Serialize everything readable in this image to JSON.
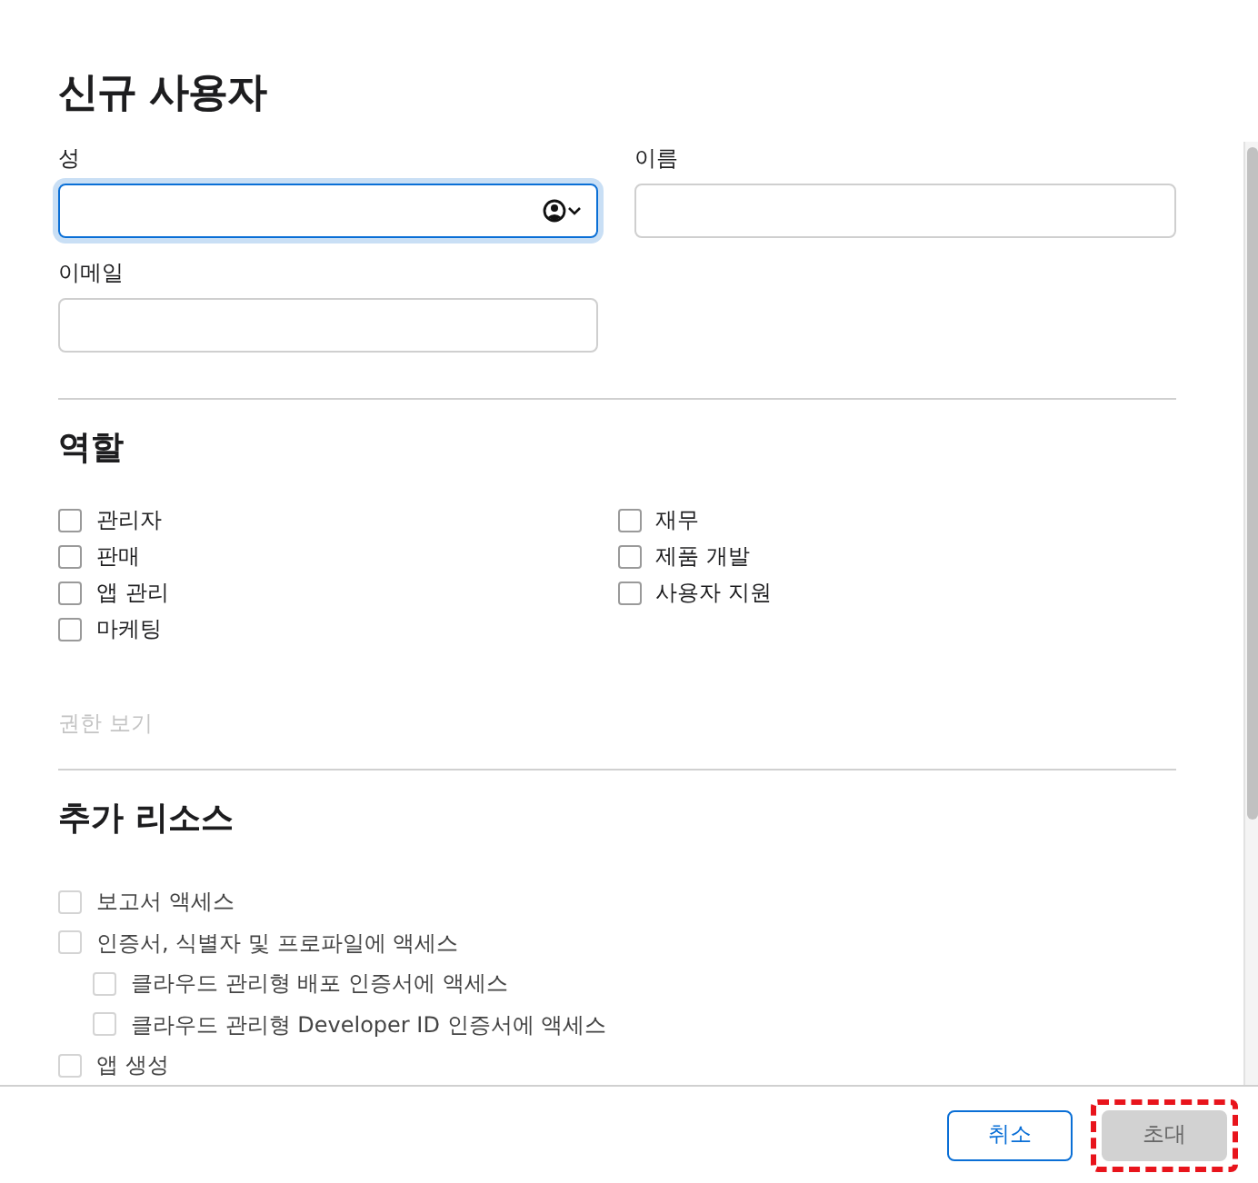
{
  "title": "신규 사용자",
  "fields": [
    {
      "label": "성",
      "focused": true,
      "contact_menu": true
    },
    {
      "label": "이름",
      "focused": false,
      "contact_menu": false
    },
    {
      "label": "이메일",
      "focused": false,
      "contact_menu": false
    }
  ],
  "roles": {
    "heading": "역할",
    "columns": [
      [
        {
          "label": "관리자",
          "checked": false
        },
        {
          "label": "판매",
          "checked": false
        },
        {
          "label": "앱 관리",
          "checked": false
        },
        {
          "label": "마케팅",
          "checked": false
        }
      ],
      [
        {
          "label": "재무",
          "checked": false
        },
        {
          "label": "제품 개발",
          "checked": false
        },
        {
          "label": "사용자 지원",
          "checked": false
        }
      ]
    ],
    "link": {
      "label": "권한 보기",
      "disabled": true
    }
  },
  "resources": {
    "heading": "추가 리소스",
    "items": [
      {
        "label": "보고서 액세스",
        "checked": false,
        "disabled": true
      },
      {
        "label": "인증서, 식별자 및 프로파일에 액세스",
        "checked": false,
        "disabled": true,
        "children": [
          {
            "label": "클라우드 관리형 배포 인증서에 액세스",
            "checked": false,
            "disabled": true
          },
          {
            "label": "클라우드 관리형 Developer ID 인증서에 액세스",
            "checked": false,
            "disabled": true
          }
        ]
      },
      {
        "label": "앱 생성",
        "checked": false,
        "disabled": true
      }
    ]
  },
  "buttons": [
    {
      "label": "취소",
      "kind": "secondary",
      "disabled": false,
      "highlighted": false
    },
    {
      "label": "초대",
      "kind": "primary",
      "disabled": true,
      "highlighted": true
    }
  ]
}
